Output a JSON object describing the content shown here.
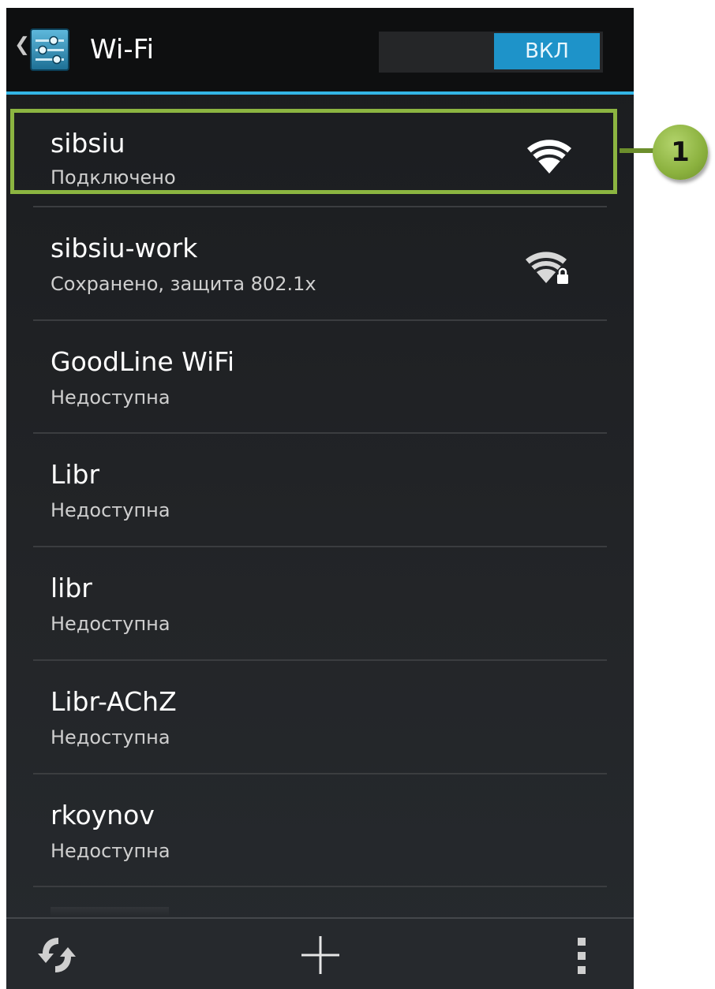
{
  "actionbar": {
    "title": "Wi-Fi",
    "toggle_label": "ВКЛ",
    "up_icon": "chevron-left-icon",
    "app_icon": "settings-sliders-icon"
  },
  "networks": [
    {
      "name": "sibsiu",
      "status": "Подключено",
      "icon": "wifi-signal-icon"
    },
    {
      "name": "sibsiu-work",
      "status": "Сохранено, защита 802.1x",
      "icon": "wifi-locked-icon"
    },
    {
      "name": "GoodLine WiFi",
      "status": "Недоступна"
    },
    {
      "name": "Libr",
      "status": "Недоступна"
    },
    {
      "name": "libr",
      "status": "Недоступна"
    },
    {
      "name": "Libr-AChZ",
      "status": "Недоступна"
    },
    {
      "name": "rkoynov",
      "status": "Недоступна"
    }
  ],
  "callout": {
    "number": "1"
  },
  "bottombar": {
    "icons": [
      "scan-icon",
      "add-icon",
      "overflow-menu-icon"
    ]
  },
  "colors": {
    "accent": "#33b5e5",
    "toggle_on": "#1e93c9",
    "highlight": "#8cb541"
  }
}
